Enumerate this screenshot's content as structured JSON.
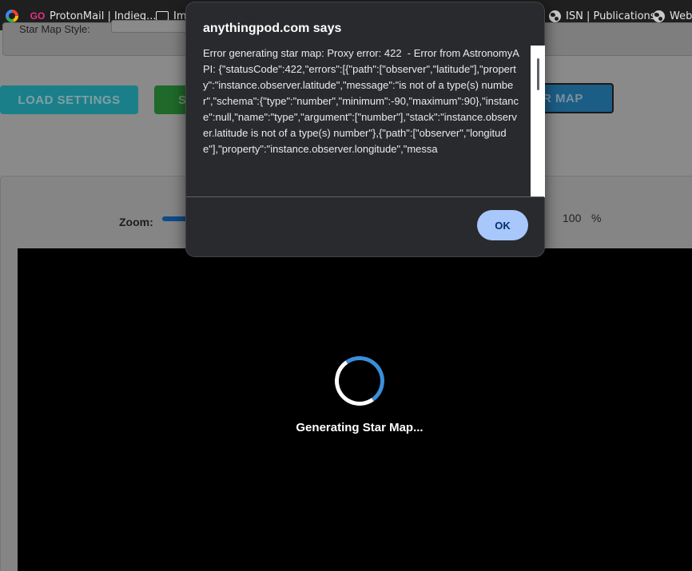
{
  "bookmarks": [
    {
      "icon": "google-icon",
      "label": ""
    },
    {
      "icon": "protonmail-go-icon",
      "icon_text": "GO",
      "label": "ProtonMail | Indieg..."
    },
    {
      "icon": "folder-icon",
      "label": "Im"
    },
    {
      "icon": "globe-icon",
      "label": "ISN | Publications"
    },
    {
      "icon": "globe-icon",
      "label": "Web"
    }
  ],
  "settings": {
    "style_label": "Star Map Style:"
  },
  "buttons": {
    "load": "LOAD SETTINGS",
    "save": "S",
    "generate": "R MAP"
  },
  "zoom": {
    "label": "Zoom:",
    "value": "100",
    "unit": "%"
  },
  "canvas": {
    "status": "Generating Star Map..."
  },
  "dialog": {
    "title": "anythingpod.com says",
    "message": "Error generating star map: Proxy error: 422  - Error from AstronomyAPI: {\"statusCode\":422,\"errors\":[{\"path\":[\"observer\",\"latitude\"],\"property\":\"instance.observer.latitude\",\"message\":\"is not of a type(s) number\",\"schema\":{\"type\":\"number\",\"minimum\":-90,\"maximum\":90},\"instance\":null,\"name\":\"type\",\"argument\":[\"number\"],\"stack\":\"instance.observer.latitude is not of a type(s) number\"},{\"path\":[\"observer\",\"longitude\"],\"property\":\"instance.observer.longitude\",\"messa",
    "ok_label": "OK"
  },
  "colors": {
    "dialog_bg": "#292a2d",
    "ok_button": "#a8c7fa",
    "spinner_accent": "#3a8fd8",
    "load_button": "#1b7f8a",
    "save_button": "#1f6a2a",
    "generate_button": "#1c5d85"
  }
}
